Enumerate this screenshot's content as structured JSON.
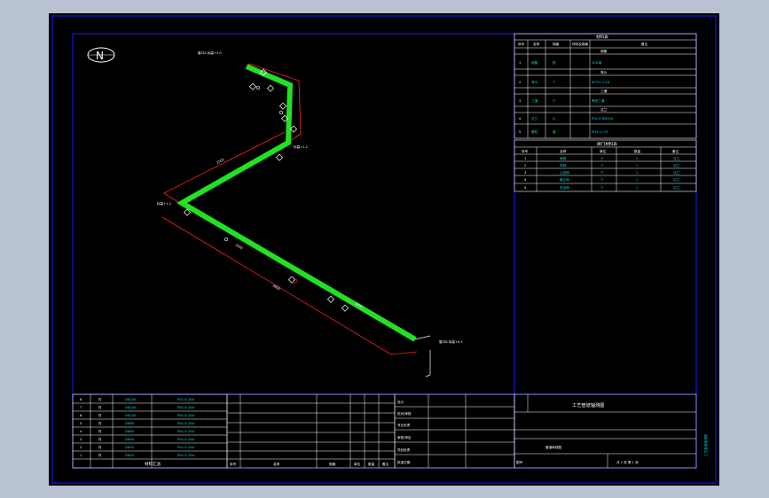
{
  "north_label": "N",
  "colors": {
    "background": "#000000",
    "frame": "#1a1aff",
    "pipe": "#22e022",
    "dimension": "#ff2020",
    "text": "#ffffff",
    "cyan_text": "#00d8d8"
  },
  "right_table_1": {
    "title": "材料表",
    "headers": [
      "序号",
      "名称",
      "规格",
      "材料及规格",
      "备注"
    ],
    "sections": [
      {
        "label": "钢管",
        "rows": [
          [
            "1",
            "钢管",
            "根",
            "20#钢"
          ]
        ]
      },
      {
        "label": "弯头",
        "rows": [
          [
            "2",
            "弯头",
            "个",
            "90°R=1.5D"
          ]
        ]
      },
      {
        "label": "三通",
        "rows": [
          [
            "3",
            "三通",
            "个",
            "等径三通"
          ]
        ]
      },
      {
        "label": "法兰",
        "rows": [
          [
            "4",
            "法兰",
            "片",
            "PN1.6 DN100"
          ],
          [
            "5",
            "螺栓",
            "套",
            "M16 L=70"
          ]
        ]
      }
    ]
  },
  "right_table_2": {
    "title": "阀门材料表",
    "headers": [
      "序号",
      "名称",
      "单位",
      "数量",
      "备注"
    ],
    "rows": [
      [
        "1",
        "闸阀",
        "个",
        "2",
        "法兰"
      ],
      [
        "2",
        "球阀",
        "个",
        "1",
        "法兰"
      ],
      [
        "3",
        "止回阀",
        "个",
        "1",
        "法兰"
      ],
      [
        "4",
        "截止阀",
        "个",
        "1",
        "法兰"
      ],
      [
        "5",
        "安全阀",
        "个",
        "1",
        "法兰"
      ]
    ]
  },
  "bottom_left_table": {
    "rows": [
      [
        "8",
        "件",
        "DN100",
        "PN1.6 20#"
      ],
      [
        "7",
        "件",
        "DN100",
        "PN1.6 20#"
      ],
      [
        "6",
        "件",
        "DN100",
        "PN1.6 20#"
      ],
      [
        "5",
        "件",
        "DN80",
        "PN1.6 20#"
      ],
      [
        "4",
        "件",
        "DN80",
        "PN1.6 20#"
      ],
      [
        "3",
        "件",
        "DN50",
        "PN1.6 20#"
      ],
      [
        "2",
        "件",
        "DN50",
        "PN1.6 20#"
      ],
      [
        "1",
        "件",
        "DN25",
        "PN1.6 20#"
      ]
    ],
    "footer": "材料汇总"
  },
  "title_block": {
    "rows_labels": [
      "设计",
      "校对/审核",
      "专业负责",
      "审核/审定",
      "项目负责",
      "批准日期"
    ],
    "col_labels": [
      "序号",
      "名称",
      "规格",
      "单位",
      "数量",
      "备注"
    ],
    "project_title": "工艺管道轴测图",
    "drawing_name": "管道单线图",
    "drawing_no_label": "图号",
    "sheet": "共 1 张 第 1 张"
  },
  "pipe_labels": {
    "start": "管口A 标高+3.0",
    "corner": "标高+1.2",
    "end": "管口B 标高+0.5",
    "dims": [
      "2500",
      "3200",
      "4800",
      "1600"
    ]
  }
}
